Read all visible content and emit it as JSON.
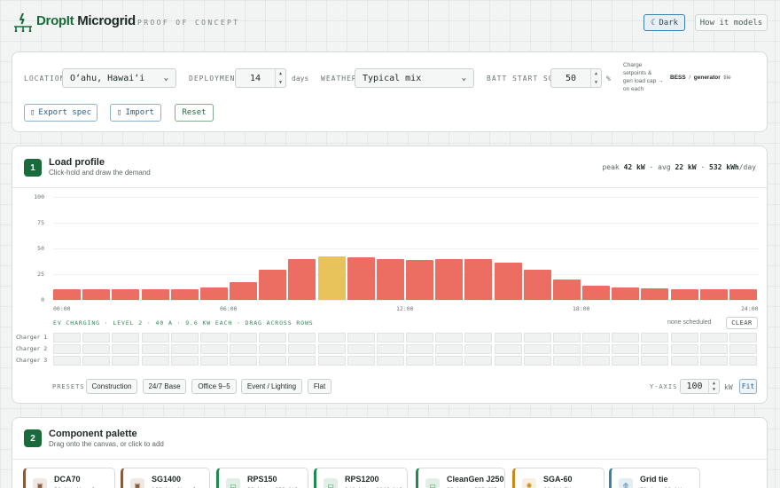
{
  "header": {
    "brand_part1": "DropIt",
    "brand_part2": "Microgrid",
    "tag": "PROOF OF CONCEPT",
    "dark_label": "Dark",
    "how_label": "How it models"
  },
  "settings": {
    "location_label": "LOCATION",
    "location_value": "O‘ahu, Hawai‘i",
    "deployment_label": "DEPLOYMENT",
    "deployment_value": "14",
    "deployment_unit": "days",
    "weather_label": "WEATHER",
    "weather_value": "Typical mix",
    "batt_label": "BATT START SOC",
    "batt_value": "50",
    "batt_unit": "%",
    "note_line1": "Charge",
    "note_line2": "setpoints &",
    "note_line3": "gen load cap →",
    "note_line4": "on each",
    "note_bess": "BESS",
    "note_slash": "/",
    "note_gen": "generator",
    "note_tile": "tile",
    "export_label": "Export spec",
    "import_label": "Import",
    "reset_label": "Reset"
  },
  "load_profile": {
    "step": "1",
    "title": "Load profile",
    "subtitle": "Click-hold and draw the demand",
    "stat_peak_label": "peak",
    "stat_peak": "42 kW",
    "stat_avg_label": "avg",
    "stat_avg": "22 kW",
    "stat_day": "532 kWh",
    "stat_day_unit": "/day",
    "stat_sep": "·",
    "y_ticks": [
      "100",
      "75",
      "50",
      "25",
      "0"
    ],
    "x_ticks": [
      "00:00",
      "06:00",
      "12:00",
      "18:00",
      "24:00"
    ],
    "ev_title": "EV CHARGING · LEVEL 2 · 40 A · 9.6 KW EACH · DRAG ACROSS ROWS",
    "ev_status": "none scheduled",
    "clear_label": "CLEAR",
    "chargers": [
      "Charger 1",
      "Charger 2",
      "Charger 3"
    ],
    "presets_label": "PRESETS",
    "presets": [
      "Construction",
      "24/7 Base",
      "Office 9–5",
      "Event / Lighting",
      "Flat"
    ],
    "yaxis_label": "Y-AXIS",
    "yaxis_value": "100",
    "yaxis_unit": "kW",
    "fit_label": "Fit",
    "colors": {
      "bar": "#ec6e63",
      "highlight": "#e8c25a"
    }
  },
  "chart_data": {
    "type": "bar",
    "categories": [
      "00:00",
      "01:00",
      "02:00",
      "03:00",
      "04:00",
      "05:00",
      "06:00",
      "07:00",
      "08:00",
      "09:00",
      "10:00",
      "11:00",
      "12:00",
      "13:00",
      "14:00",
      "15:00",
      "16:00",
      "17:00",
      "18:00",
      "19:00",
      "20:00",
      "21:00",
      "22:00",
      "23:00"
    ],
    "values": [
      10,
      10,
      10,
      10,
      10,
      12,
      17,
      29,
      40,
      42,
      41,
      40,
      39,
      40,
      40,
      36,
      29,
      20,
      14,
      12,
      11,
      10,
      10,
      10
    ],
    "highlight_index": 9,
    "ylim": [
      0,
      100
    ],
    "unit": "kW"
  },
  "palette": {
    "step": "2",
    "title": "Component palette",
    "subtitle": "Drag onto the canvas, or click to add",
    "items": [
      {
        "name": "DCA70",
        "spec": "56 kW diesel",
        "icon": "generator-icon",
        "color": "#8a5a3c"
      },
      {
        "name": "SG1400",
        "spec": "168 kW diesel",
        "icon": "generator-icon",
        "color": "#8a5a3c"
      },
      {
        "name": "RPS150",
        "spec": "30 kW · 132 kWh",
        "icon": "battery-icon",
        "color": "#1e8a4c"
      },
      {
        "name": "RPS1200",
        "spec": "240 kW · 1042 kWh",
        "icon": "battery-icon",
        "color": "#1e8a4c"
      },
      {
        "name": "CleanGen J250",
        "spec": "80 kW · 225 kWh",
        "icon": "battery-icon",
        "color": "#1e8a4c"
      },
      {
        "name": "SGA-60",
        "spec": "60 kW PV array",
        "icon": "sun-icon",
        "color": "#c98a1a"
      },
      {
        "name": "Grid tie",
        "spec": "50 A · 18 kW",
        "icon": "tower-icon",
        "color": "#3e7fa8"
      }
    ]
  }
}
